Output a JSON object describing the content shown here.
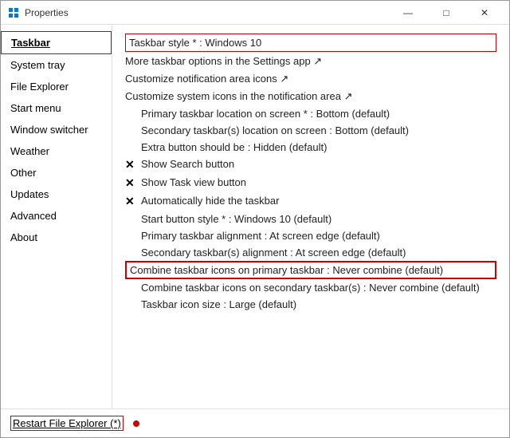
{
  "window": {
    "title": "Properties",
    "controls": {
      "minimize": "—",
      "maximize": "□",
      "close": "✕"
    }
  },
  "sidebar": {
    "items": [
      {
        "id": "taskbar",
        "label": "Taskbar",
        "active": true
      },
      {
        "id": "system-tray",
        "label": "System tray",
        "active": false
      },
      {
        "id": "file-explorer",
        "label": "File Explorer",
        "active": false
      },
      {
        "id": "start-menu",
        "label": "Start menu",
        "active": false
      },
      {
        "id": "window-switcher",
        "label": "Window switcher",
        "active": false
      },
      {
        "id": "weather",
        "label": "Weather",
        "active": false
      },
      {
        "id": "other",
        "label": "Other",
        "active": false
      },
      {
        "id": "updates",
        "label": "Updates",
        "active": false
      },
      {
        "id": "advanced",
        "label": "Advanced",
        "active": false
      },
      {
        "id": "about",
        "label": "About",
        "active": false
      }
    ]
  },
  "main": {
    "settings": [
      {
        "id": "taskbar-style",
        "text": "Taskbar style * : Windows 10",
        "indent": 0,
        "prefix": "",
        "highlighted": true,
        "boxed": false
      },
      {
        "id": "more-options",
        "text": "More taskbar options in the Settings app ↗",
        "indent": 0,
        "prefix": "",
        "highlighted": false,
        "boxed": false
      },
      {
        "id": "customize-notif",
        "text": "Customize notification area icons ↗",
        "indent": 0,
        "prefix": "",
        "highlighted": false,
        "boxed": false
      },
      {
        "id": "customize-sys",
        "text": "Customize system icons in the notification area ↗",
        "indent": 0,
        "prefix": "",
        "highlighted": false,
        "boxed": false
      },
      {
        "id": "primary-location",
        "text": "Primary taskbar location on screen * : Bottom (default)",
        "indent": 1,
        "prefix": "",
        "highlighted": false,
        "boxed": false
      },
      {
        "id": "secondary-location",
        "text": "Secondary taskbar(s) location on screen : Bottom (default)",
        "indent": 1,
        "prefix": "",
        "highlighted": false,
        "boxed": false
      },
      {
        "id": "extra-button",
        "text": "Extra button should be : Hidden (default)",
        "indent": 1,
        "prefix": "",
        "highlighted": false,
        "boxed": false
      },
      {
        "id": "show-search",
        "text": "Show Search button",
        "indent": 0,
        "prefix": "✕",
        "highlighted": false,
        "boxed": false
      },
      {
        "id": "show-task-view",
        "text": "Show Task view button",
        "indent": 0,
        "prefix": "✕",
        "highlighted": false,
        "boxed": false
      },
      {
        "id": "auto-hide",
        "text": "Automatically hide the taskbar",
        "indent": 0,
        "prefix": "✕",
        "highlighted": false,
        "boxed": false
      },
      {
        "id": "start-btn-style",
        "text": "Start button style * : Windows 10 (default)",
        "indent": 1,
        "prefix": "",
        "highlighted": false,
        "boxed": false
      },
      {
        "id": "primary-alignment",
        "text": "Primary taskbar alignment : At screen edge (default)",
        "indent": 1,
        "prefix": "",
        "highlighted": false,
        "boxed": false
      },
      {
        "id": "secondary-alignment",
        "text": "Secondary taskbar(s) alignment : At screen edge (default)",
        "indent": 1,
        "prefix": "",
        "highlighted": false,
        "boxed": false
      },
      {
        "id": "combine-primary",
        "text": "Combine taskbar icons on primary taskbar : Never combine (default)",
        "indent": 1,
        "prefix": "",
        "highlighted": false,
        "boxed": true
      },
      {
        "id": "combine-secondary",
        "text": "Combine taskbar icons on secondary taskbar(s) : Never combine (default)",
        "indent": 1,
        "prefix": "",
        "highlighted": false,
        "boxed": false
      },
      {
        "id": "icon-size",
        "text": "Taskbar icon size : Large (default)",
        "indent": 1,
        "prefix": "",
        "highlighted": false,
        "boxed": false
      }
    ]
  },
  "footer": {
    "restart_label": "Restart File Explorer (*)"
  }
}
